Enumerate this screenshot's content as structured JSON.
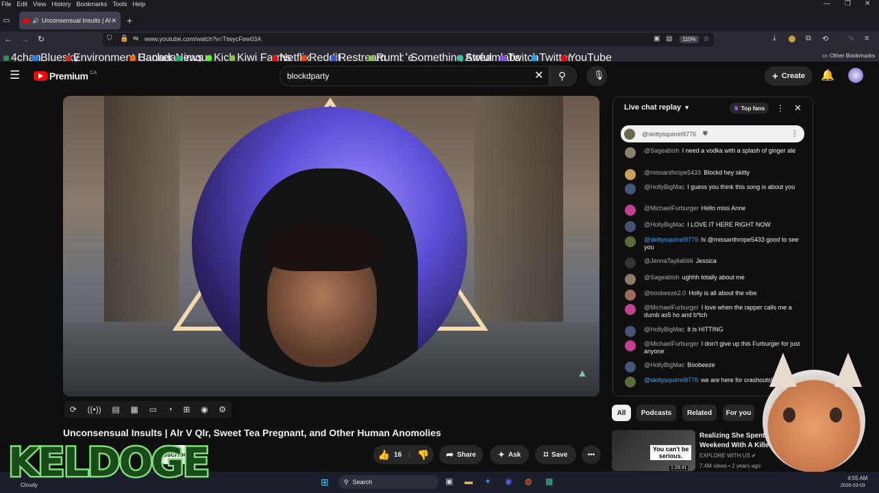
{
  "browser": {
    "menu": [
      "File",
      "Edit",
      "View",
      "History",
      "Bookmarks",
      "Tools",
      "Help"
    ],
    "tab_title": "Unconsensual Insults | Alr V",
    "url": "www.youtube.com/watch?v=TtwycFew03A",
    "zoom": "110%",
    "bookmarks": [
      {
        "label": "4chan",
        "color": "#2e8b57"
      },
      {
        "label": "Bluesky",
        "color": "#1185fe"
      },
      {
        "label": "Environment Canada",
        "color": "#d52b1e"
      },
      {
        "label": "Hacker News",
        "color": "#ff6600"
      },
      {
        "label": "imgur",
        "color": "#1bb76e"
      },
      {
        "label": "Kick",
        "color": "#53fc18"
      },
      {
        "label": "Kiwi Farms",
        "color": "#8bc34a"
      },
      {
        "label": "Netflix",
        "color": "#e50914"
      },
      {
        "label": "Reddit",
        "color": "#ff4500"
      },
      {
        "label": "Restream",
        "color": "#3b5bdb"
      },
      {
        "label": "Rumble",
        "color": "#85c742"
      },
      {
        "label": "Something Awful",
        "color": "#222222"
      },
      {
        "label": "Streamlabs",
        "color": "#31c3a2"
      },
      {
        "label": "Twitch",
        "color": "#9146ff"
      },
      {
        "label": "Twitter",
        "color": "#1da1f2"
      },
      {
        "label": "YouTube",
        "color": "#ff0000"
      }
    ],
    "other_bookmarks": "Other Bookmarks"
  },
  "youtube": {
    "logo_text": "Premium",
    "logo_sup": "CA",
    "search_value": "blockdparty",
    "create_label": "Create"
  },
  "video": {
    "title": "Unconsensual Insults | Alr V Qlr, Sweet Tea Pregnant, and Other Human Anomolies",
    "subscribe": "bscribe",
    "likes": "16",
    "share": "Share",
    "ask": "Ask",
    "save": "Save"
  },
  "chat": {
    "header": "Live chat replay",
    "top_fans": "Top fans",
    "pinned_author": "@skittysquirrel9776",
    "messages": [
      {
        "author": "@Sageabish",
        "text": "I need a vodka with a splash of ginger ale",
        "color": "#8a7f6a"
      },
      {
        "author": "@missanthrope5433",
        "text": "Blockd hey skitty",
        "color": "#c9a05a"
      },
      {
        "author": "@HollyBigMac",
        "text": "I guess you think this song is about you",
        "color": "#445577"
      },
      {
        "author": "@MichaelFurburger",
        "text": "Hello miss Anne",
        "color": "#c2408f"
      },
      {
        "author": "@HollyBigMac",
        "text": "I LOVE IT HERE RIGHT NOW",
        "color": "#445577"
      },
      {
        "author": "@skittysquirrel9776",
        "text": "hi @missanthrope5433 good to see you",
        "color": "#5a6a3a"
      },
      {
        "author": "@JennaTaylia666",
        "text": "Jessica",
        "color": "#333333"
      },
      {
        "author": "@Sageabish",
        "text": "ughhh totally about me",
        "color": "#8a7f6a"
      },
      {
        "author": "@boobeeze2.0",
        "text": "Holly is all about the vibe",
        "color": "#a06a5a"
      },
      {
        "author": "@MichaelFurburger",
        "text": "I love when the rapper calls me a dumb as5 ho and b*tch",
        "color": "#c2408f"
      },
      {
        "author": "@HollyBigMac",
        "text": "It is HITTING",
        "color": "#445577"
      },
      {
        "author": "@MichaelFurburger",
        "text": "I don't give up this Furburger for just anyone",
        "color": "#c2408f"
      },
      {
        "author": "@HollyBigMac",
        "text": "Boobeeze",
        "color": "#445577"
      },
      {
        "author": "@skittysquirrel9776",
        "text": "we are here for crashouts!",
        "color": "#5a6a3a"
      }
    ]
  },
  "chips": [
    "All",
    "Podcasts",
    "Related",
    "For you"
  ],
  "recommended": {
    "title": "Realizing She Spent Weekend With A Killer",
    "channel": "EXPLORE WITH US",
    "meta": "7.4M views • 2 years ago",
    "thumb_text": "You can't be serious.",
    "duration": "1:29:41"
  },
  "taskbar": {
    "weather": "Cloudy",
    "search": "Search",
    "time": "4:55 AM",
    "date": "2026-03-03"
  },
  "overlay": {
    "logo_text": "KELDOGE"
  }
}
